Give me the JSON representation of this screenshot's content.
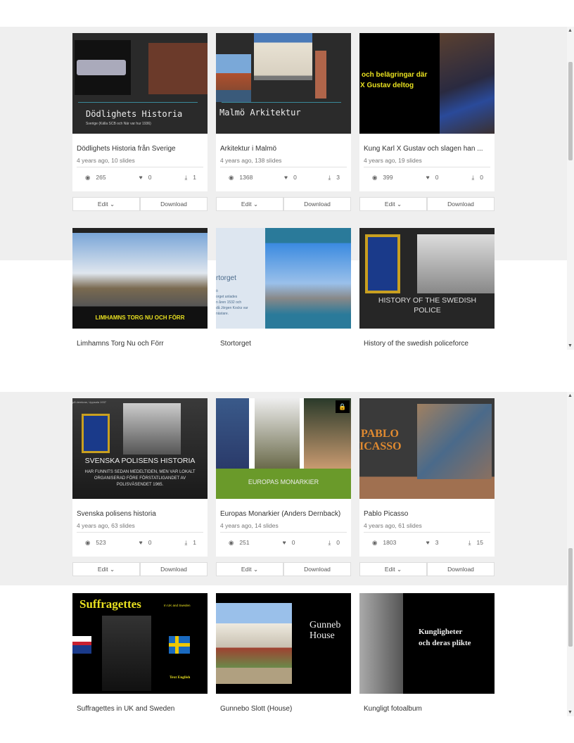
{
  "panel1": {
    "cards": [
      {
        "title": "Dödlighets Historia från Sverige",
        "meta": "4 years ago, 10 slides",
        "views": "265",
        "likes": "0",
        "downloads": "1",
        "thumb_title": "Dödlighets Historia",
        "thumb_sub": "Sverige  (Källa SCB och När var hur 1936)"
      },
      {
        "title": "Arkitektur i Malmö",
        "meta": "4 years ago, 138 slides",
        "views": "1368",
        "likes": "0",
        "downloads": "3",
        "thumb_title": "Malmö Arkitektur"
      },
      {
        "title": "Kung Karl X Gustav och slagen han ...",
        "meta": "4 years ago, 19 slides",
        "views": "399",
        "likes": "0",
        "downloads": "0",
        "thumb_line1": "och belägringar där",
        "thumb_line2": "X Gustav deltog"
      }
    ],
    "row2": [
      {
        "title": "Limhamns Torg Nu och Förr",
        "thumb_title": "LIMHAMNS TORG NU OCH FÖRR"
      },
      {
        "title": "Stortorget",
        "thumb_title": "rtorget",
        "thumb_body": "ö\norget anlades\nn åren 1532 och\ndå Jörgen Kocks var\nnästare."
      },
      {
        "title": "History of the swedish policeforce",
        "thumb_title": "HISTORY OF THE SWEDISH POLICE"
      }
    ]
  },
  "panel2": {
    "cards": [
      {
        "title": "Svenska polisens historia",
        "meta": "4 years ago, 63 slides",
        "views": "523",
        "likes": "0",
        "downloads": "1",
        "thumb_caption": "på demkran, Uppsala 1937",
        "thumb_title": "SVENSKA POLISENS HISTORIA",
        "thumb_sub": "HAR FUNNITS SEDAN MEDELTIDEN, MEN VAR LOKALT ORGANISERAD FÖRE FÖRSTATLIGANDET AV POLISVÄSENDET 1965."
      },
      {
        "title": "Europas Monarkier (Anders Dernback)",
        "meta": "4 years ago, 14 slides",
        "views": "251",
        "likes": "0",
        "downloads": "0",
        "thumb_title": "EUROPAS MONARKIER",
        "locked": true
      },
      {
        "title": "Pablo Picasso",
        "meta": "4 years ago, 61 slides",
        "views": "1803",
        "likes": "3",
        "downloads": "15",
        "thumb_line1": "PABLO",
        "thumb_line2": "ICASSO"
      }
    ],
    "row2": [
      {
        "title": "Suffragettes in UK and Sweden",
        "thumb_title": "Suffragettes",
        "thumb_sub": "In UK and Sweden",
        "thumb_note": "Text English"
      },
      {
        "title": "Gunnebo Slott (House)",
        "thumb_line1": "Gunneb",
        "thumb_line2": "House"
      },
      {
        "title": "Kungligt fotoalbum",
        "thumb_line1": "Kungligheter",
        "thumb_line2": "och deras plikte"
      }
    ]
  },
  "buttons": {
    "edit": "Edit",
    "edit_chevron": "⌄",
    "download": "Download"
  },
  "icons": {
    "views": "◉",
    "likes": "♥",
    "downloads": "⤓",
    "lock": "🔒"
  }
}
